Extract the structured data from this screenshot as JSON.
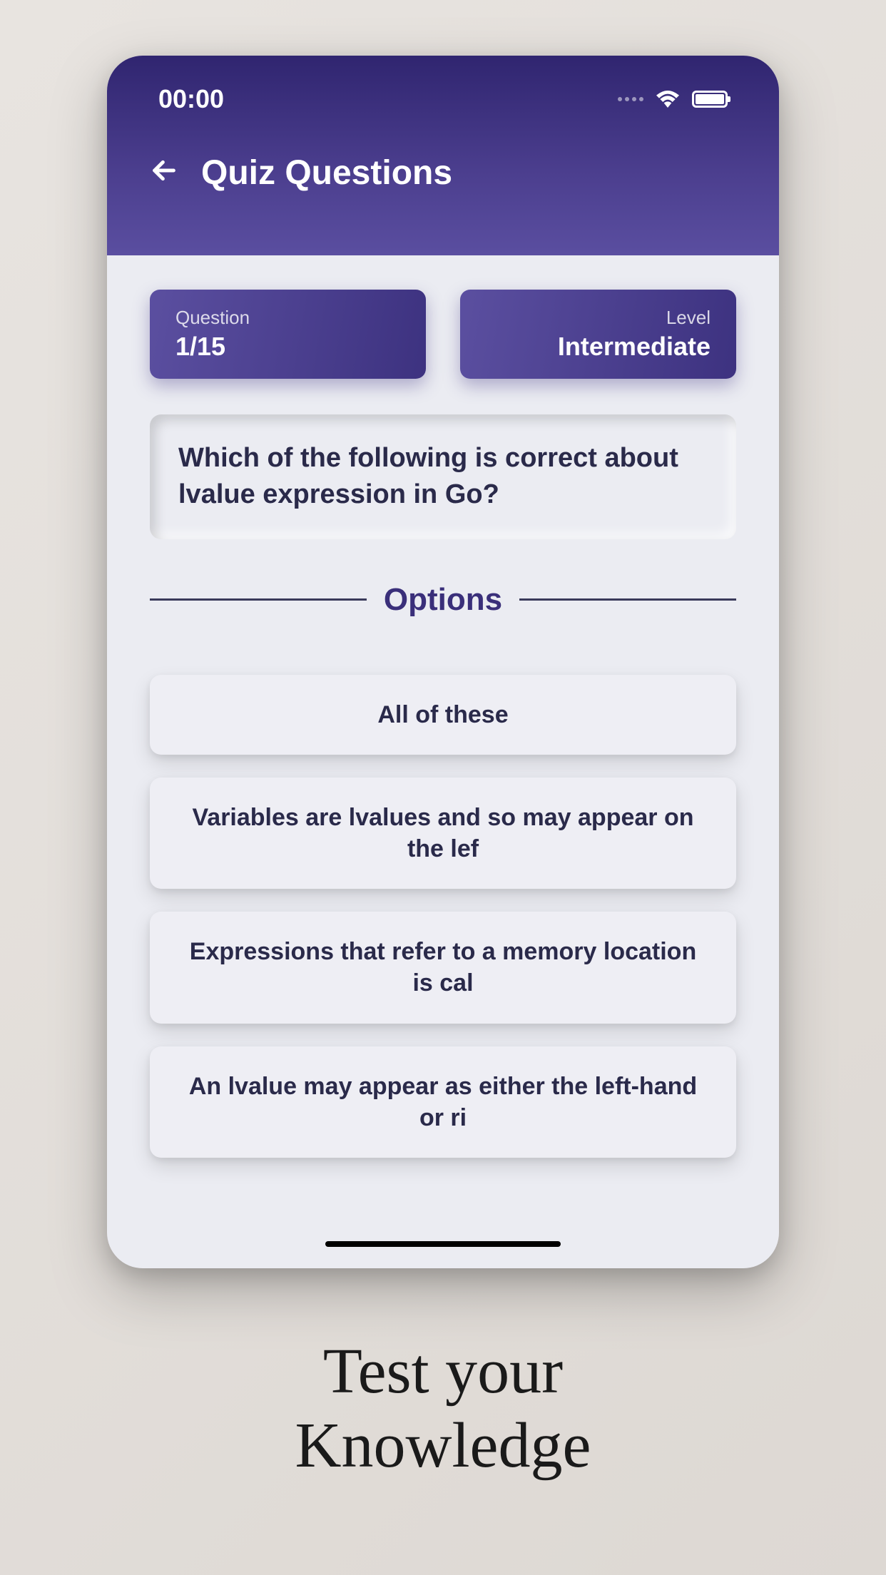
{
  "status": {
    "time": "00:00"
  },
  "header": {
    "title": "Quiz Questions"
  },
  "quiz": {
    "question_label": "Question",
    "question_progress": "1/15",
    "level_label": "Level",
    "level_value": "Intermediate",
    "question_text": "Which of the following is correct about lvalue expression in Go?"
  },
  "options": {
    "header": "Options",
    "items": [
      "All of these",
      "Variables are lvalues and so may appear on the lef",
      "Expressions that refer to a memory location is cal",
      "An lvalue may appear as either the left-hand or ri"
    ]
  },
  "tagline": "Test your\nKnowledge"
}
